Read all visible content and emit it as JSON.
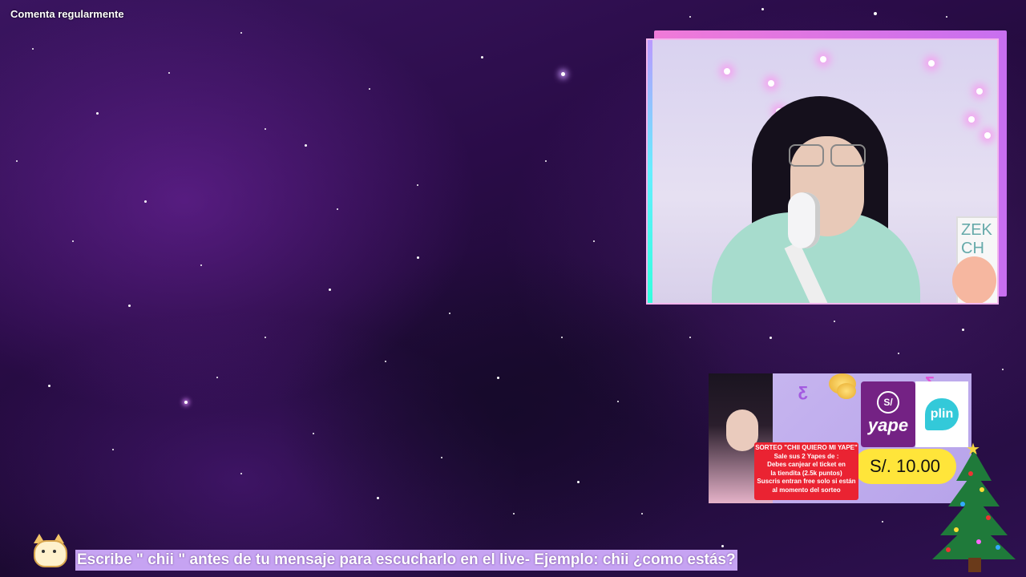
{
  "overlay": {
    "top_label": "Comenta regularmente",
    "bottom_message": "Escribe \" chii \" antes de tu mensaje para escucharlo en el live- Ejemplo: chii ¿como estás?"
  },
  "webcam": {
    "whiteboard_text": "ZEK CH"
  },
  "promo": {
    "yape_symbol": "S/",
    "yape_label": "yape",
    "plin_label": "plin",
    "price": "S/. 10.00",
    "rules": [
      "SORTEO \"CHII QUIERO MI YAPE\"",
      "Sale sus 2 Yapes de :",
      "Debes canjear el ticket en",
      "la tiendita (2.5k puntos)",
      "Suscris entran free solo si están",
      "al momento del sorteo"
    ]
  },
  "colors": {
    "yape_brand": "#742284",
    "plin_brand": "#33c9d9",
    "price_bg": "#ffe53a",
    "rules_bg": "#ea2332",
    "bottom_bar_bg": "#c6a3f2"
  }
}
